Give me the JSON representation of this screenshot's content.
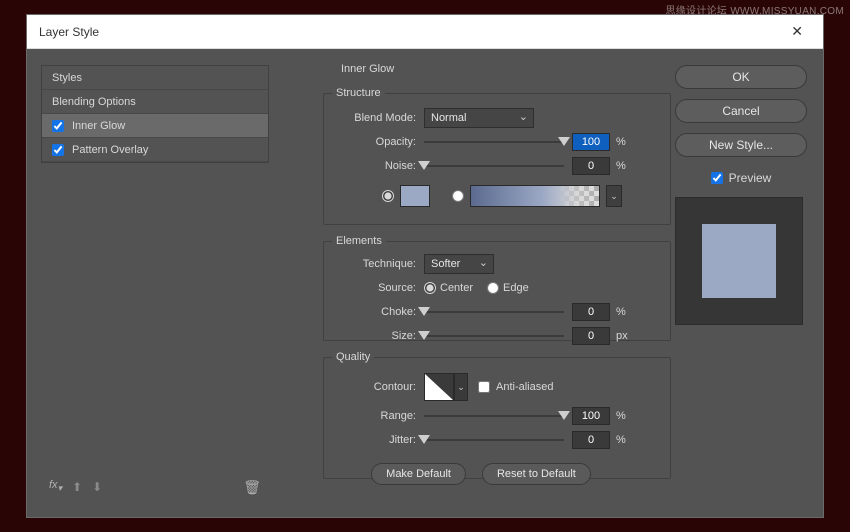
{
  "window": {
    "title": "Layer Style"
  },
  "left": {
    "styles_header": "Styles",
    "blending_header": "Blending Options",
    "items": [
      {
        "label": "Inner Glow",
        "checked": true,
        "selected": true
      },
      {
        "label": "Pattern Overlay",
        "checked": true,
        "selected": false
      }
    ],
    "fx_label": "fx"
  },
  "panel_title": "Inner Glow",
  "structure": {
    "legend": "Structure",
    "blend_mode_label": "Blend Mode:",
    "blend_mode_value": "Normal",
    "opacity_label": "Opacity:",
    "opacity_value": "100",
    "opacity_unit": "%",
    "noise_label": "Noise:",
    "noise_value": "0",
    "noise_unit": "%"
  },
  "elements": {
    "legend": "Elements",
    "technique_label": "Technique:",
    "technique_value": "Softer",
    "source_label": "Source:",
    "source_center": "Center",
    "source_edge": "Edge",
    "choke_label": "Choke:",
    "choke_value": "0",
    "choke_unit": "%",
    "size_label": "Size:",
    "size_value": "0",
    "size_unit": "px"
  },
  "quality": {
    "legend": "Quality",
    "contour_label": "Contour:",
    "antialiased_label": "Anti-aliased",
    "range_label": "Range:",
    "range_value": "100",
    "range_unit": "%",
    "jitter_label": "Jitter:",
    "jitter_value": "0",
    "jitter_unit": "%"
  },
  "buttons": {
    "make_default": "Make Default",
    "reset_default": "Reset to Default",
    "ok": "OK",
    "cancel": "Cancel",
    "new_style": "New Style..."
  },
  "preview": {
    "label": "Preview"
  },
  "colors": {
    "glow": "#9ba9c5"
  },
  "watermark": "思缘设计论坛   WWW.MISSYUAN.COM"
}
